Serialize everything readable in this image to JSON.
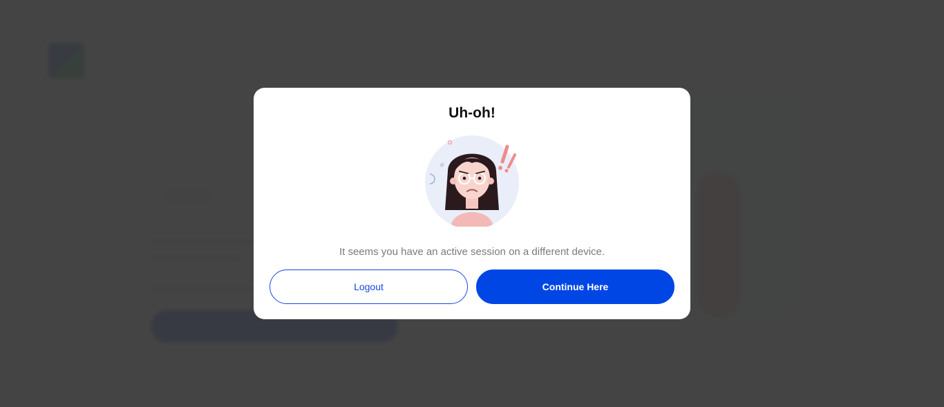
{
  "dialog": {
    "title": "Uh-oh!",
    "message": "It seems you have an active session on a different device.",
    "logout_label": "Logout",
    "continue_label": "Continue Here",
    "illustration_icon": "worried-woman-illustration"
  },
  "colors": {
    "primary": "#0046e5",
    "overlay": "#3a3a3a",
    "message_text": "#7a7a7a"
  }
}
